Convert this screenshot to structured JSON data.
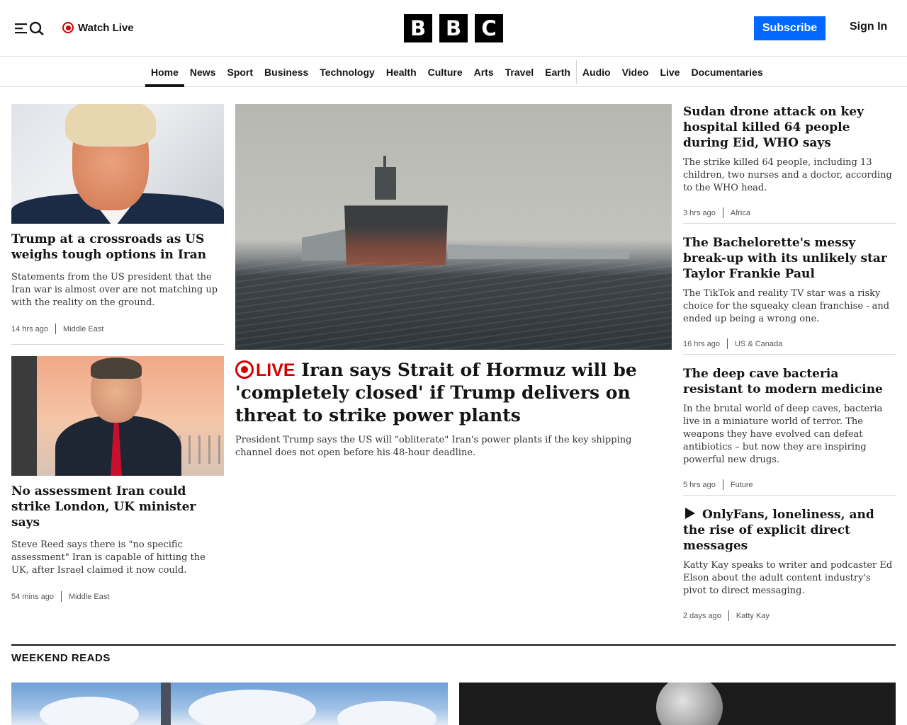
{
  "header": {
    "watch_live": "Watch Live",
    "logo_letters": [
      "B",
      "B",
      "C"
    ],
    "subscribe": "Subscribe",
    "sign_in": "Sign In",
    "icons": [
      "menu-icon",
      "search-icon",
      "live-icon"
    ]
  },
  "nav": {
    "items": [
      "Home",
      "News",
      "Sport",
      "Business",
      "Technology",
      "Health",
      "Culture",
      "Arts",
      "Travel",
      "Earth",
      "Audio",
      "Video",
      "Live",
      "Documentaries"
    ],
    "active": "Home"
  },
  "left": {
    "cards": [
      {
        "headline": "Trump at a crossroads as US weighs tough options in Iran",
        "summary": "Statements from the US president that the Iran war is almost over are not matching up with the reality on the ground.",
        "time": "14 hrs ago",
        "section": "Middle East"
      },
      {
        "headline": "No assessment Iran could strike London, UK minister says",
        "summary": "Steve Reed says there is \"no specific assessment\" Iran is capable of hitting the UK, after Israel claimed it now could.",
        "time": "54 mins ago",
        "section": "Middle East"
      }
    ]
  },
  "hero": {
    "live_label": "LIVE",
    "headline": "Iran says Strait of Hormuz will be 'completely closed' if Trump delivers on threat to strike power plants",
    "summary": "President Trump says the US will \"obliterate\" Iran's power plants if the key shipping channel does not open before his 48-hour deadline."
  },
  "right": {
    "cards": [
      {
        "headline": "Sudan drone attack on key hospital killed 64 people during Eid, WHO says",
        "summary": "The strike killed 64 people, including 13 children, two nurses and a doctor, according to the WHO head.",
        "time": "3 hrs ago",
        "section": "Africa"
      },
      {
        "headline": "The Bachelorette's messy break-up with its unlikely star Taylor Frankie Paul",
        "summary": "The TikTok and reality TV star was a risky choice for the squeaky clean franchise - and ended up being a wrong one.",
        "time": "16 hrs ago",
        "section": "US & Canada"
      },
      {
        "headline": "The deep cave bacteria resistant to modern medicine",
        "summary": "In the brutal world of deep caves, bacteria live in a miniature world of terror. The weapons they have evolved can defeat antibiotics – but now they are inspiring powerful new drugs.",
        "time": "5 hrs ago",
        "section": "Future"
      },
      {
        "headline": "OnlyFans, loneliness, and the rise of explicit direct messages",
        "summary": "Katty Kay speaks to writer and podcaster Ed Elson about the adult content industry's pivot to direct messaging.",
        "time": "2 days ago",
        "section": "Katty Kay"
      }
    ]
  },
  "weekend": {
    "title": "WEEKEND READS"
  },
  "colors": {
    "accent": "#0068ff",
    "live": "#d40000",
    "text": "#141414"
  }
}
